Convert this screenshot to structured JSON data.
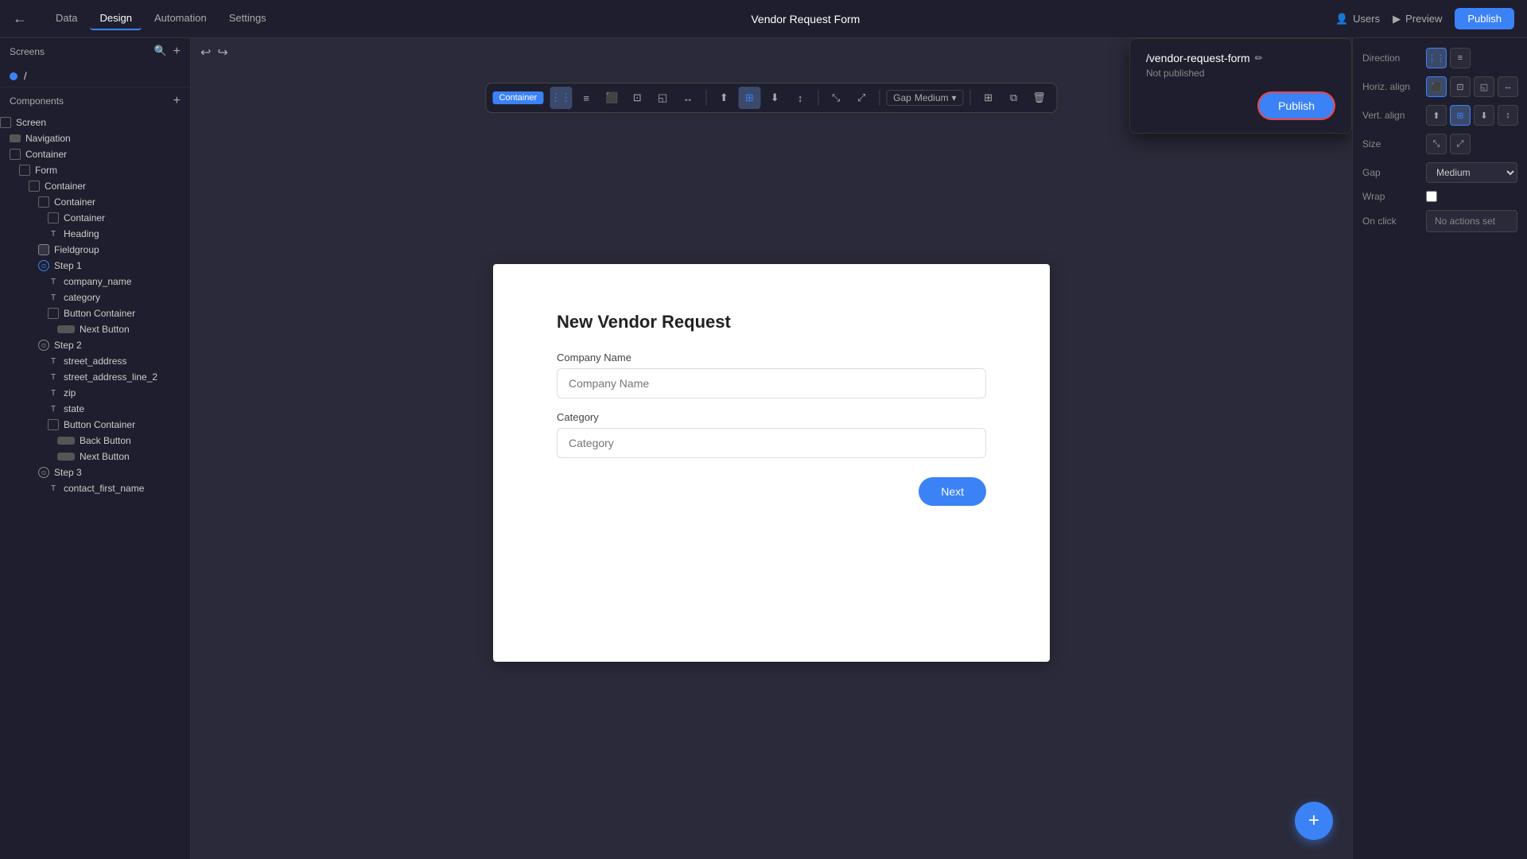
{
  "app": {
    "title": "Vendor Request Form",
    "back_icon": "←",
    "tabs": [
      {
        "label": "Data",
        "active": false
      },
      {
        "label": "Design",
        "active": true
      },
      {
        "label": "Automation",
        "active": false
      },
      {
        "label": "Settings",
        "active": false
      }
    ],
    "right_actions": {
      "users_label": "Users",
      "preview_label": "Preview",
      "publish_label": "Publish"
    }
  },
  "sidebar": {
    "screens_title": "Screens",
    "screens": [
      {
        "label": "/",
        "active": true
      }
    ],
    "components_title": "Components",
    "tree": [
      {
        "label": "Screen",
        "indent": 0,
        "icon": "screen"
      },
      {
        "label": "Navigation",
        "indent": 1,
        "icon": "nav"
      },
      {
        "label": "Container",
        "indent": 1,
        "icon": "sq"
      },
      {
        "label": "Form",
        "indent": 2,
        "icon": "sq"
      },
      {
        "label": "Container",
        "indent": 3,
        "icon": "sq"
      },
      {
        "label": "Container",
        "indent": 4,
        "icon": "sq"
      },
      {
        "label": "Container",
        "indent": 5,
        "icon": "sq"
      },
      {
        "label": "Heading",
        "indent": 5,
        "icon": "t"
      },
      {
        "label": "Fieldgroup",
        "indent": 4,
        "icon": "fg"
      },
      {
        "label": "Step 1",
        "indent": 4,
        "icon": "step"
      },
      {
        "label": "company_name",
        "indent": 5,
        "icon": "t"
      },
      {
        "label": "category",
        "indent": 5,
        "icon": "t"
      },
      {
        "label": "Button Container",
        "indent": 5,
        "icon": "sq"
      },
      {
        "label": "Next Button",
        "indent": 6,
        "icon": "btn"
      },
      {
        "label": "Step 2",
        "indent": 4,
        "icon": "step"
      },
      {
        "label": "street_address",
        "indent": 5,
        "icon": "t"
      },
      {
        "label": "street_address_line_2",
        "indent": 5,
        "icon": "t"
      },
      {
        "label": "zip",
        "indent": 5,
        "icon": "t"
      },
      {
        "label": "state",
        "indent": 5,
        "icon": "t"
      },
      {
        "label": "Button Container",
        "indent": 5,
        "icon": "sq"
      },
      {
        "label": "Back Button",
        "indent": 6,
        "icon": "btn"
      },
      {
        "label": "Next Button",
        "indent": 6,
        "icon": "btn"
      },
      {
        "label": "Step 3",
        "indent": 4,
        "icon": "step"
      },
      {
        "label": "contact_first_name",
        "indent": 5,
        "icon": "t"
      }
    ]
  },
  "toolbar": {
    "container_badge": "Container",
    "gap_label": "Gap",
    "gap_value": "Medium"
  },
  "form": {
    "title": "New Vendor Request",
    "fields": [
      {
        "label": "Company Name",
        "placeholder": "Company Name"
      },
      {
        "label": "Category",
        "placeholder": "Category"
      }
    ],
    "next_btn": "Next"
  },
  "right_panel": {
    "direction_label": "Direction",
    "horiz_align_label": "Horiz. align",
    "vert_align_label": "Vert. align",
    "size_label": "Size",
    "gap_label": "Gap",
    "gap_value": "Medium",
    "wrap_label": "Wrap",
    "on_click_label": "On click",
    "no_actions": "No actions set"
  },
  "publish_popup": {
    "route": "/vendor-request-form",
    "status": "Not published",
    "publish_btn": "Publish"
  },
  "fab": {
    "icon": "+"
  }
}
